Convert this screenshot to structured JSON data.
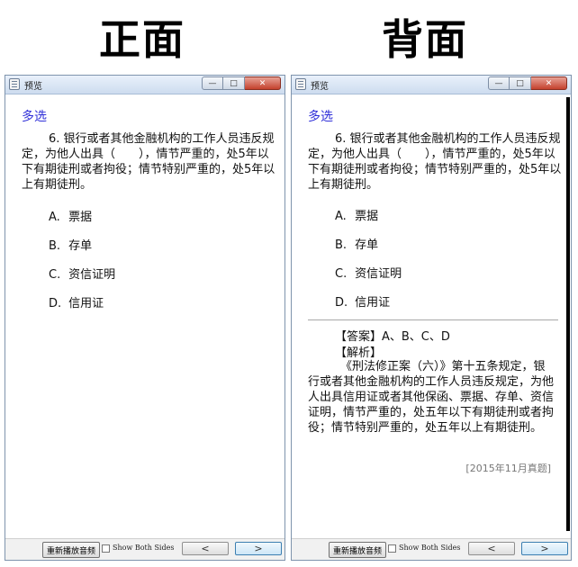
{
  "headings": {
    "front": "正面",
    "back": "背面"
  },
  "window": {
    "title": "预览",
    "controls": {
      "minimize": "—",
      "maximize": "□",
      "close": "✕"
    }
  },
  "question": {
    "type": "多选",
    "stem": "6. 银行或者其他金融机构的工作人员违反规定，为他人出具（　　），情节严重的，处5年以下有期徒刑或者拘役；情节特别严重的，处5年以上有期徒刑。",
    "options": [
      {
        "letter": "A.",
        "text": "票据"
      },
      {
        "letter": "B.",
        "text": "存单"
      },
      {
        "letter": "C.",
        "text": "资信证明"
      },
      {
        "letter": "D.",
        "text": "信用证"
      }
    ]
  },
  "answer": {
    "line": "【答案】A、B、C、D",
    "analysis_label": "【解析】",
    "analysis": "《刑法修正案（六）》第十五条规定，银行或者其他金融机构的工作人员违反规定，为他人出具信用证或者其他保函、票据、存单、资信证明，情节严重的，处五年以下有期徒刑或者拘役；情节特别严重的，处五年以上有期徒刑。",
    "source": "[2015年11月真题]"
  },
  "bottom_bar": {
    "replay_label": "重新播放音频",
    "show_both_label": "Show Both Sides",
    "prev_label": "<",
    "next_label": ">"
  }
}
